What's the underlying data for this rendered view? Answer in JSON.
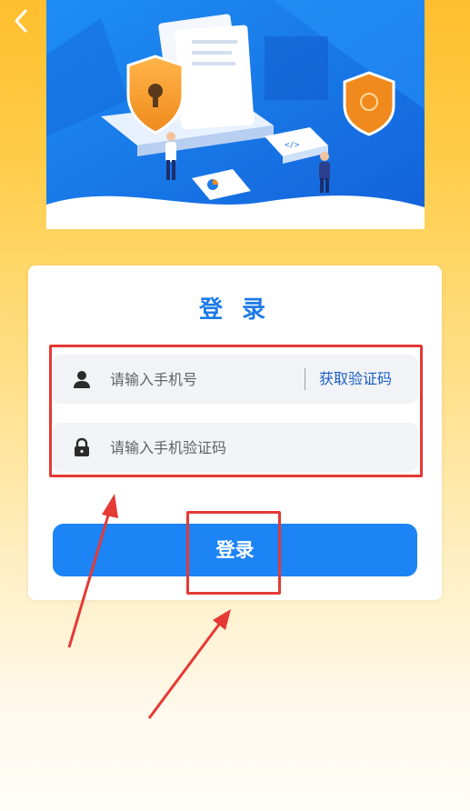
{
  "header": {
    "back_icon": "chevron-left-icon"
  },
  "hero": {
    "illustration": "security-illustration"
  },
  "login_card": {
    "title": "登 录",
    "phone_field": {
      "icon": "user-icon",
      "placeholder": "请输入手机号",
      "value": "",
      "get_code_label": "获取验证码"
    },
    "code_field": {
      "icon": "lock-icon",
      "placeholder": "请输入手机验证码",
      "value": ""
    },
    "submit_label": "登录"
  },
  "colors": {
    "accent": "#1c84f5",
    "title_blue": "#1e7be6",
    "link_blue": "#1a5fc7",
    "annotation_red": "#e53935",
    "background_top": "#ffbe2e",
    "background_bottom": "#fffdf8"
  }
}
